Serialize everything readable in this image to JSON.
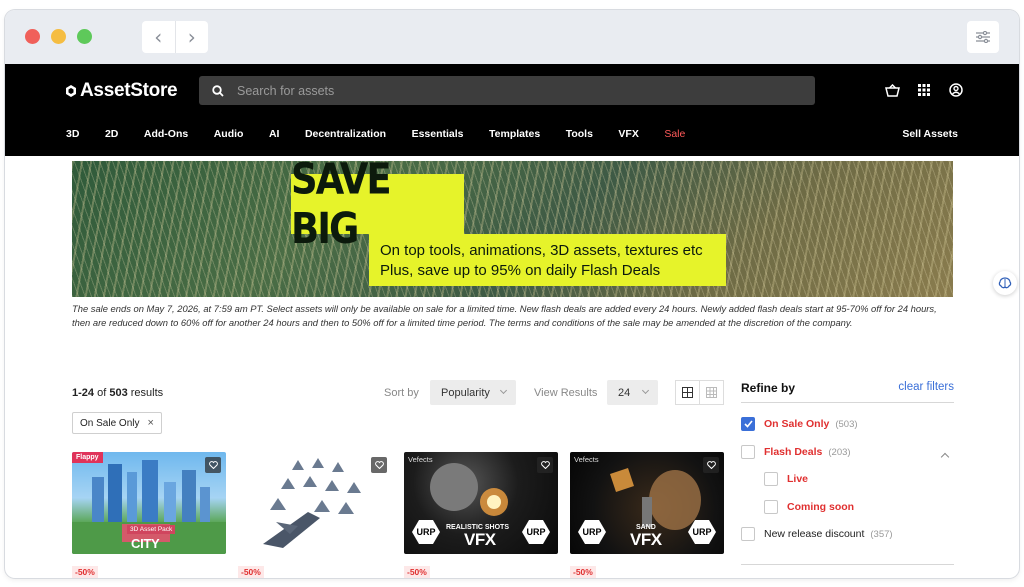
{
  "header": {
    "logo_text": "AssetStore",
    "search_placeholder": "Search for assets",
    "categories": [
      "3D",
      "2D",
      "Add-Ons",
      "Audio",
      "AI",
      "Decentralization",
      "Essentials",
      "Templates",
      "Tools",
      "VFX",
      "Sale"
    ],
    "sell_label": "Sell Assets"
  },
  "banner": {
    "headline": "SAVE BIG",
    "line1": "On top tools, animations, 3D assets, textures etc",
    "line2": "Plus, save up to 95% on daily Flash Deals"
  },
  "terms": "The sale ends on May 7, 2026, at 7:59 am PT. Select assets will only be available on sale for a limited time. New flash deals are added every 24 hours. Newly added flash deals start at 95-70% off for 24 hours, then are reduced down to 60% off for another 24 hours and then to 50% off for a limited time period. The terms and conditions of the sale may be amended at the discretion of the company.",
  "results": {
    "range": "1-24",
    "of": "of",
    "total": "503",
    "suffix": "results"
  },
  "sort": {
    "label": "Sort by",
    "value": "Popularity"
  },
  "view": {
    "label": "View Results",
    "value": "24"
  },
  "active_filter": {
    "label": "On Sale Only",
    "remove": "×"
  },
  "refine": {
    "title": "Refine by",
    "clear": "clear filters",
    "items": [
      {
        "label": "On Sale Only",
        "count": "(503)",
        "checked": true
      },
      {
        "label": "Flash Deals",
        "count": "(203)",
        "checked": false
      },
      {
        "label": "Live"
      },
      {
        "label": "Coming soon"
      },
      {
        "label": "New release discount",
        "count": "(357)",
        "checked": false
      }
    ]
  },
  "cards": [
    {
      "publisher": "Flappy",
      "badge": "3D Asset Pack",
      "title": "CITY",
      "discount": "-50%"
    },
    {
      "discount": "-50%"
    },
    {
      "publisher": "Vefects",
      "sub": "REALISTIC SHOTS",
      "title": "VFX",
      "urp": "URP",
      "discount": "-50%"
    },
    {
      "publisher": "Vefects",
      "sub": "SAND",
      "title": "VFX",
      "urp": "URP",
      "discount": "-50%"
    }
  ]
}
